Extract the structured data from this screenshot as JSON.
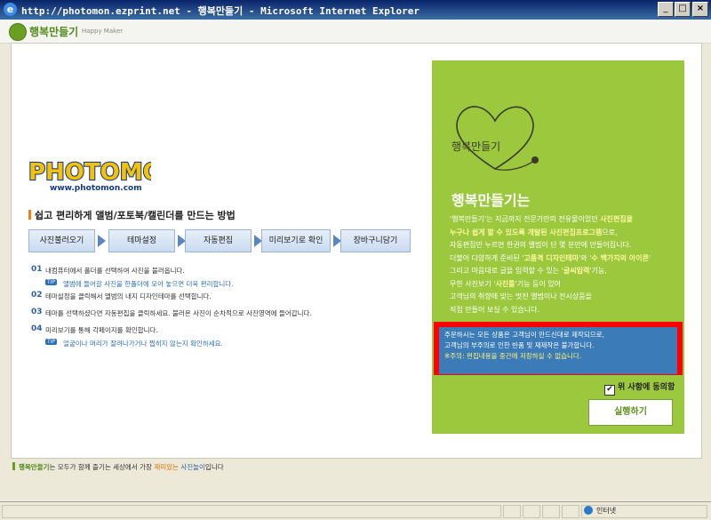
{
  "window": {
    "title": "http://photomon.ezprint.net - 행복만들기 - Microsoft Internet Explorer",
    "icon": "ie-icon",
    "buttons": [
      "_",
      "□",
      "×"
    ]
  },
  "app": {
    "title": "행복만들기",
    "subtitle": "Happy Maker"
  },
  "left": {
    "logo_text": "PHOTOMON",
    "logo_url": "www.photomon.com",
    "how_title": "쉽고 편리하게 앨범/포토북/캘린더를 만드는 방법",
    "steps": [
      "사진불러오기",
      "테마설정",
      "자동편집",
      "미리보기로 확인",
      "장바구니담기"
    ],
    "instructions": [
      {
        "num": "01",
        "text": "내컴퓨터에서 폴더를 선택하여 사진을 불러옵니다.",
        "tip_label": "TIP",
        "tip": "앨범에 들어갈 사진을 한폴더에 모아 놓으면 더욱 편리합니다."
      },
      {
        "num": "02",
        "text": "테마설정을 클릭해서 앨범의 내지 디자인테마를 선택합니다."
      },
      {
        "num": "03",
        "text": "테마를 선택하셨다면 자동편집을 클릭하세요. 불러온 사진이 순차적으로 사진영역에 들어갑니다."
      },
      {
        "num": "04",
        "text": "미리보기를 통해 각페이지를 확인합니다.",
        "tip_label": "TIP",
        "tip": "얼굴이나 머리가 잘려나가거나 찝히지 않는지 확인하세요."
      }
    ]
  },
  "panel": {
    "heart_text": "행복만들기",
    "title": "행복만들기는",
    "desc": [
      {
        "a": "'행복만들기'는 지금까지 전문가만의 전유물이었던 ",
        "b": "사진편집을"
      },
      {
        "a": "",
        "b": "누구나 쉽게 할 수 있도록 개발된 사진편집프로그램",
        "c": "으로,"
      },
      {
        "a": "자동편집만 누르면 한권의 앨범이 단 몇 분만에 만들어집니다.",
        "b": ""
      },
      {
        "a": "더불어 다양하게 준비된 '",
        "b": "고품격 디자인테마",
        "c": "'와 '",
        "d": "수 백가지의 아이콘",
        "e": "'"
      },
      {
        "a": "그리고 마음대로 글을 입력할 수 있는 '",
        "b": "글씨입력",
        "c": "'기능,"
      },
      {
        "a": "무한 사진보기 '",
        "b": "사진틀",
        "c": "'기능 등이 있어"
      },
      {
        "a": "고객님의 취향에 맞는 멋진 앨범이나 전시상품을",
        "b": ""
      },
      {
        "a": "직접 만들어 보실 수 있습니다.",
        "b": ""
      }
    ],
    "notice": [
      "주문하시는 모든 상품은 고객님이 만드신대로 제작되므로,",
      "고객님의 부주의로 인한 반품 및 재제작은 불가합니다.",
      "※주의: 편집내용을 중간에 저장하실 수 없습니다."
    ],
    "agree_label": "위 사항에 동의함",
    "run_label": "실행하기"
  },
  "footer": {
    "part1": "행복만들기",
    "part2": "는 모두가 함께 즐기는 세상에서 가장 ",
    "part3": "재미있는",
    "part4": " ",
    "part5": "사진놀이",
    "part6": "입니다"
  },
  "status": {
    "zone": "인터넷"
  },
  "colors": {
    "panel_green": "#9bc83c",
    "notice_red": "#ff0000",
    "notice_blue": "#3a7bb8",
    "title_blue": "#0a246a"
  }
}
